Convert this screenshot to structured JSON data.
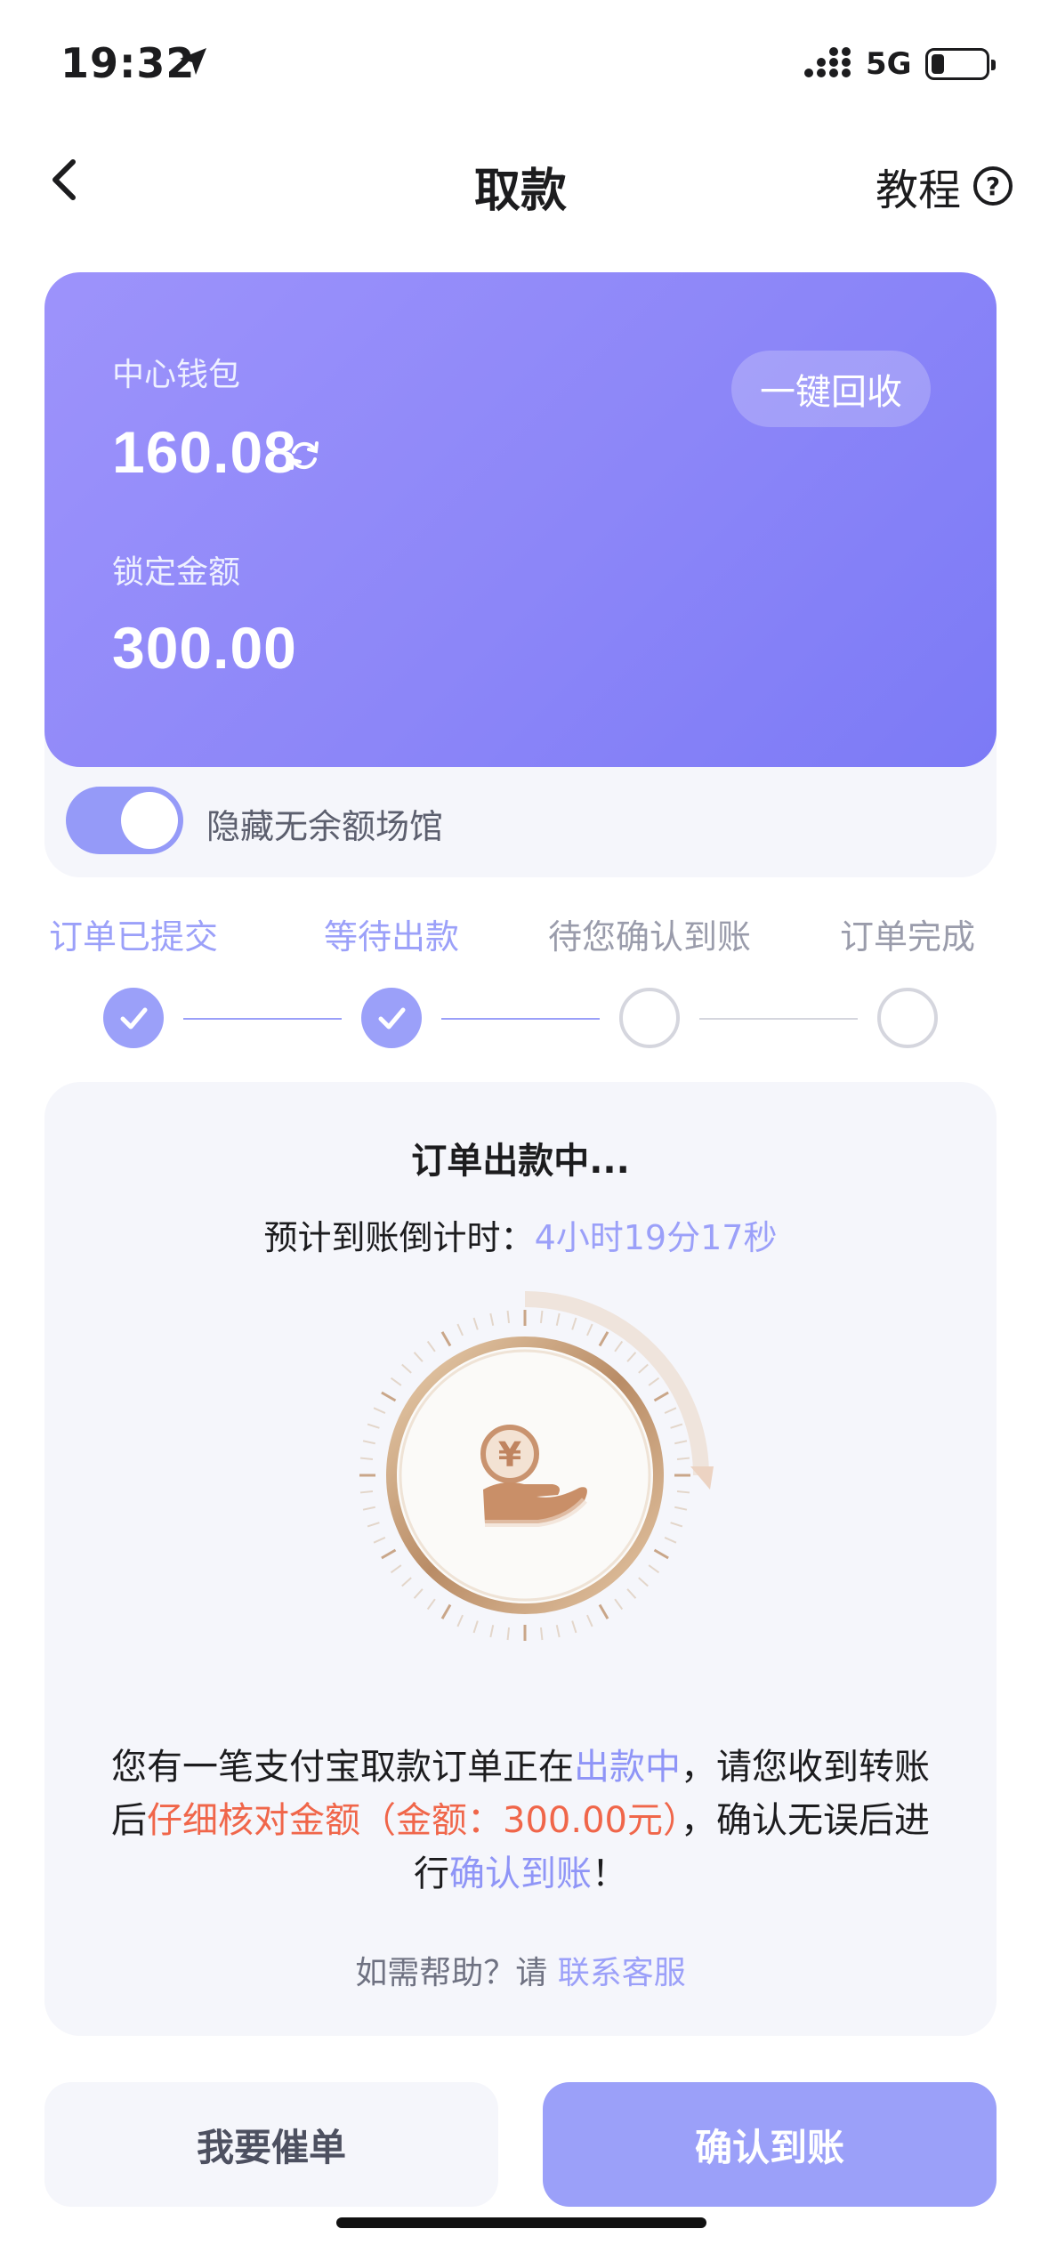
{
  "status_bar": {
    "time": "19:32",
    "network": "5G",
    "battery_percent": 20
  },
  "nav": {
    "title": "取款",
    "tutorial_label": "教程"
  },
  "wallet": {
    "center_label": "中心钱包",
    "center_amount": "160.08",
    "locked_label": "锁定金额",
    "locked_amount": "300.00",
    "recycle_label": "一键回收",
    "colors": {
      "gradient_start": "#9d93fb",
      "gradient_end": "#7c7af6"
    }
  },
  "hide_toggle": {
    "label": "隐藏无余额场馆",
    "on": true
  },
  "steps": [
    {
      "label": "订单已提交",
      "done": true
    },
    {
      "label": "等待出款",
      "done": true
    },
    {
      "label": "待您确认到账",
      "done": false
    },
    {
      "label": "订单完成",
      "done": false
    }
  ],
  "order": {
    "title": "订单出款中...",
    "countdown_label": "预计到账倒计时：",
    "countdown_value": "4小时19分17秒",
    "progress_fraction": 0.25,
    "message": {
      "p1": "您有一笔支付宝取款订单正在",
      "p2": "出款中",
      "p3": "，请您收到转账后",
      "p4": "仔细核对金额（金额：300.00元）",
      "p5": "，确认无误后进行",
      "p6": "确认到账",
      "p7": "！"
    },
    "help_prefix": "如需帮助？请 ",
    "help_link": "联系客服"
  },
  "buttons": {
    "urge": "我要催单",
    "confirm": "确认到账"
  },
  "accent_color": "#9ba0f9",
  "warning_color": "#f0664a"
}
